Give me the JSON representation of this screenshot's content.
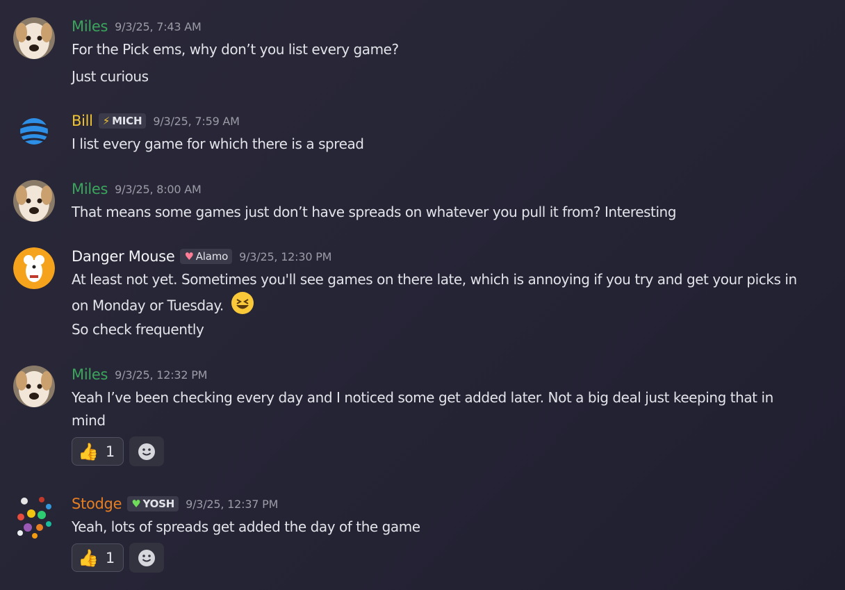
{
  "messages": [
    {
      "username": "Miles",
      "color": "#3ba55d",
      "timestamp": "9/3/25, 7:43 AM",
      "lines": [
        "For the Pick ems, why don’t you list every game?",
        "Just curious"
      ]
    },
    {
      "username": "Bill",
      "color": "#f0c430",
      "tag": {
        "icon": "lightning-icon",
        "label": "MICH"
      },
      "timestamp": "9/3/25, 7:59 AM",
      "lines": [
        "I list every game for which there is a spread"
      ]
    },
    {
      "username": "Miles",
      "color": "#3ba55d",
      "timestamp": "9/3/25, 8:00 AM",
      "lines": [
        "That means some games just don’t have spreads on whatever you pull it from? Interesting"
      ]
    },
    {
      "username": "Danger Mouse",
      "color": "#f2f3f5",
      "tag": {
        "icon": "heart-icon",
        "label": "Alamo"
      },
      "timestamp": "9/3/25, 12:30 PM",
      "lines": [
        "At least not yet. Sometimes you'll see games on there late, which is annoying if you try and get your picks in",
        "on Monday or Tuesday.",
        "So check frequently"
      ],
      "emoji": "laughing-emoji"
    },
    {
      "username": "Miles",
      "color": "#3ba55d",
      "timestamp": "9/3/25, 12:32 PM",
      "lines": [
        "Yeah I’ve been checking every day and I noticed some get added later. Not a big deal just keeping that in",
        "mind"
      ],
      "reaction": {
        "emoji": "thumbs-up-emoji",
        "count": "1"
      }
    },
    {
      "username": "Stodge",
      "color": "#e67e22",
      "tag": {
        "icon": "green-heart-icon",
        "label": "YOSH"
      },
      "timestamp": "9/3/25, 12:37 PM",
      "lines": [
        "Yeah, lots of spreads get added the day of the game"
      ],
      "reaction": {
        "emoji": "thumbs-up-emoji",
        "count": "1"
      }
    }
  ]
}
